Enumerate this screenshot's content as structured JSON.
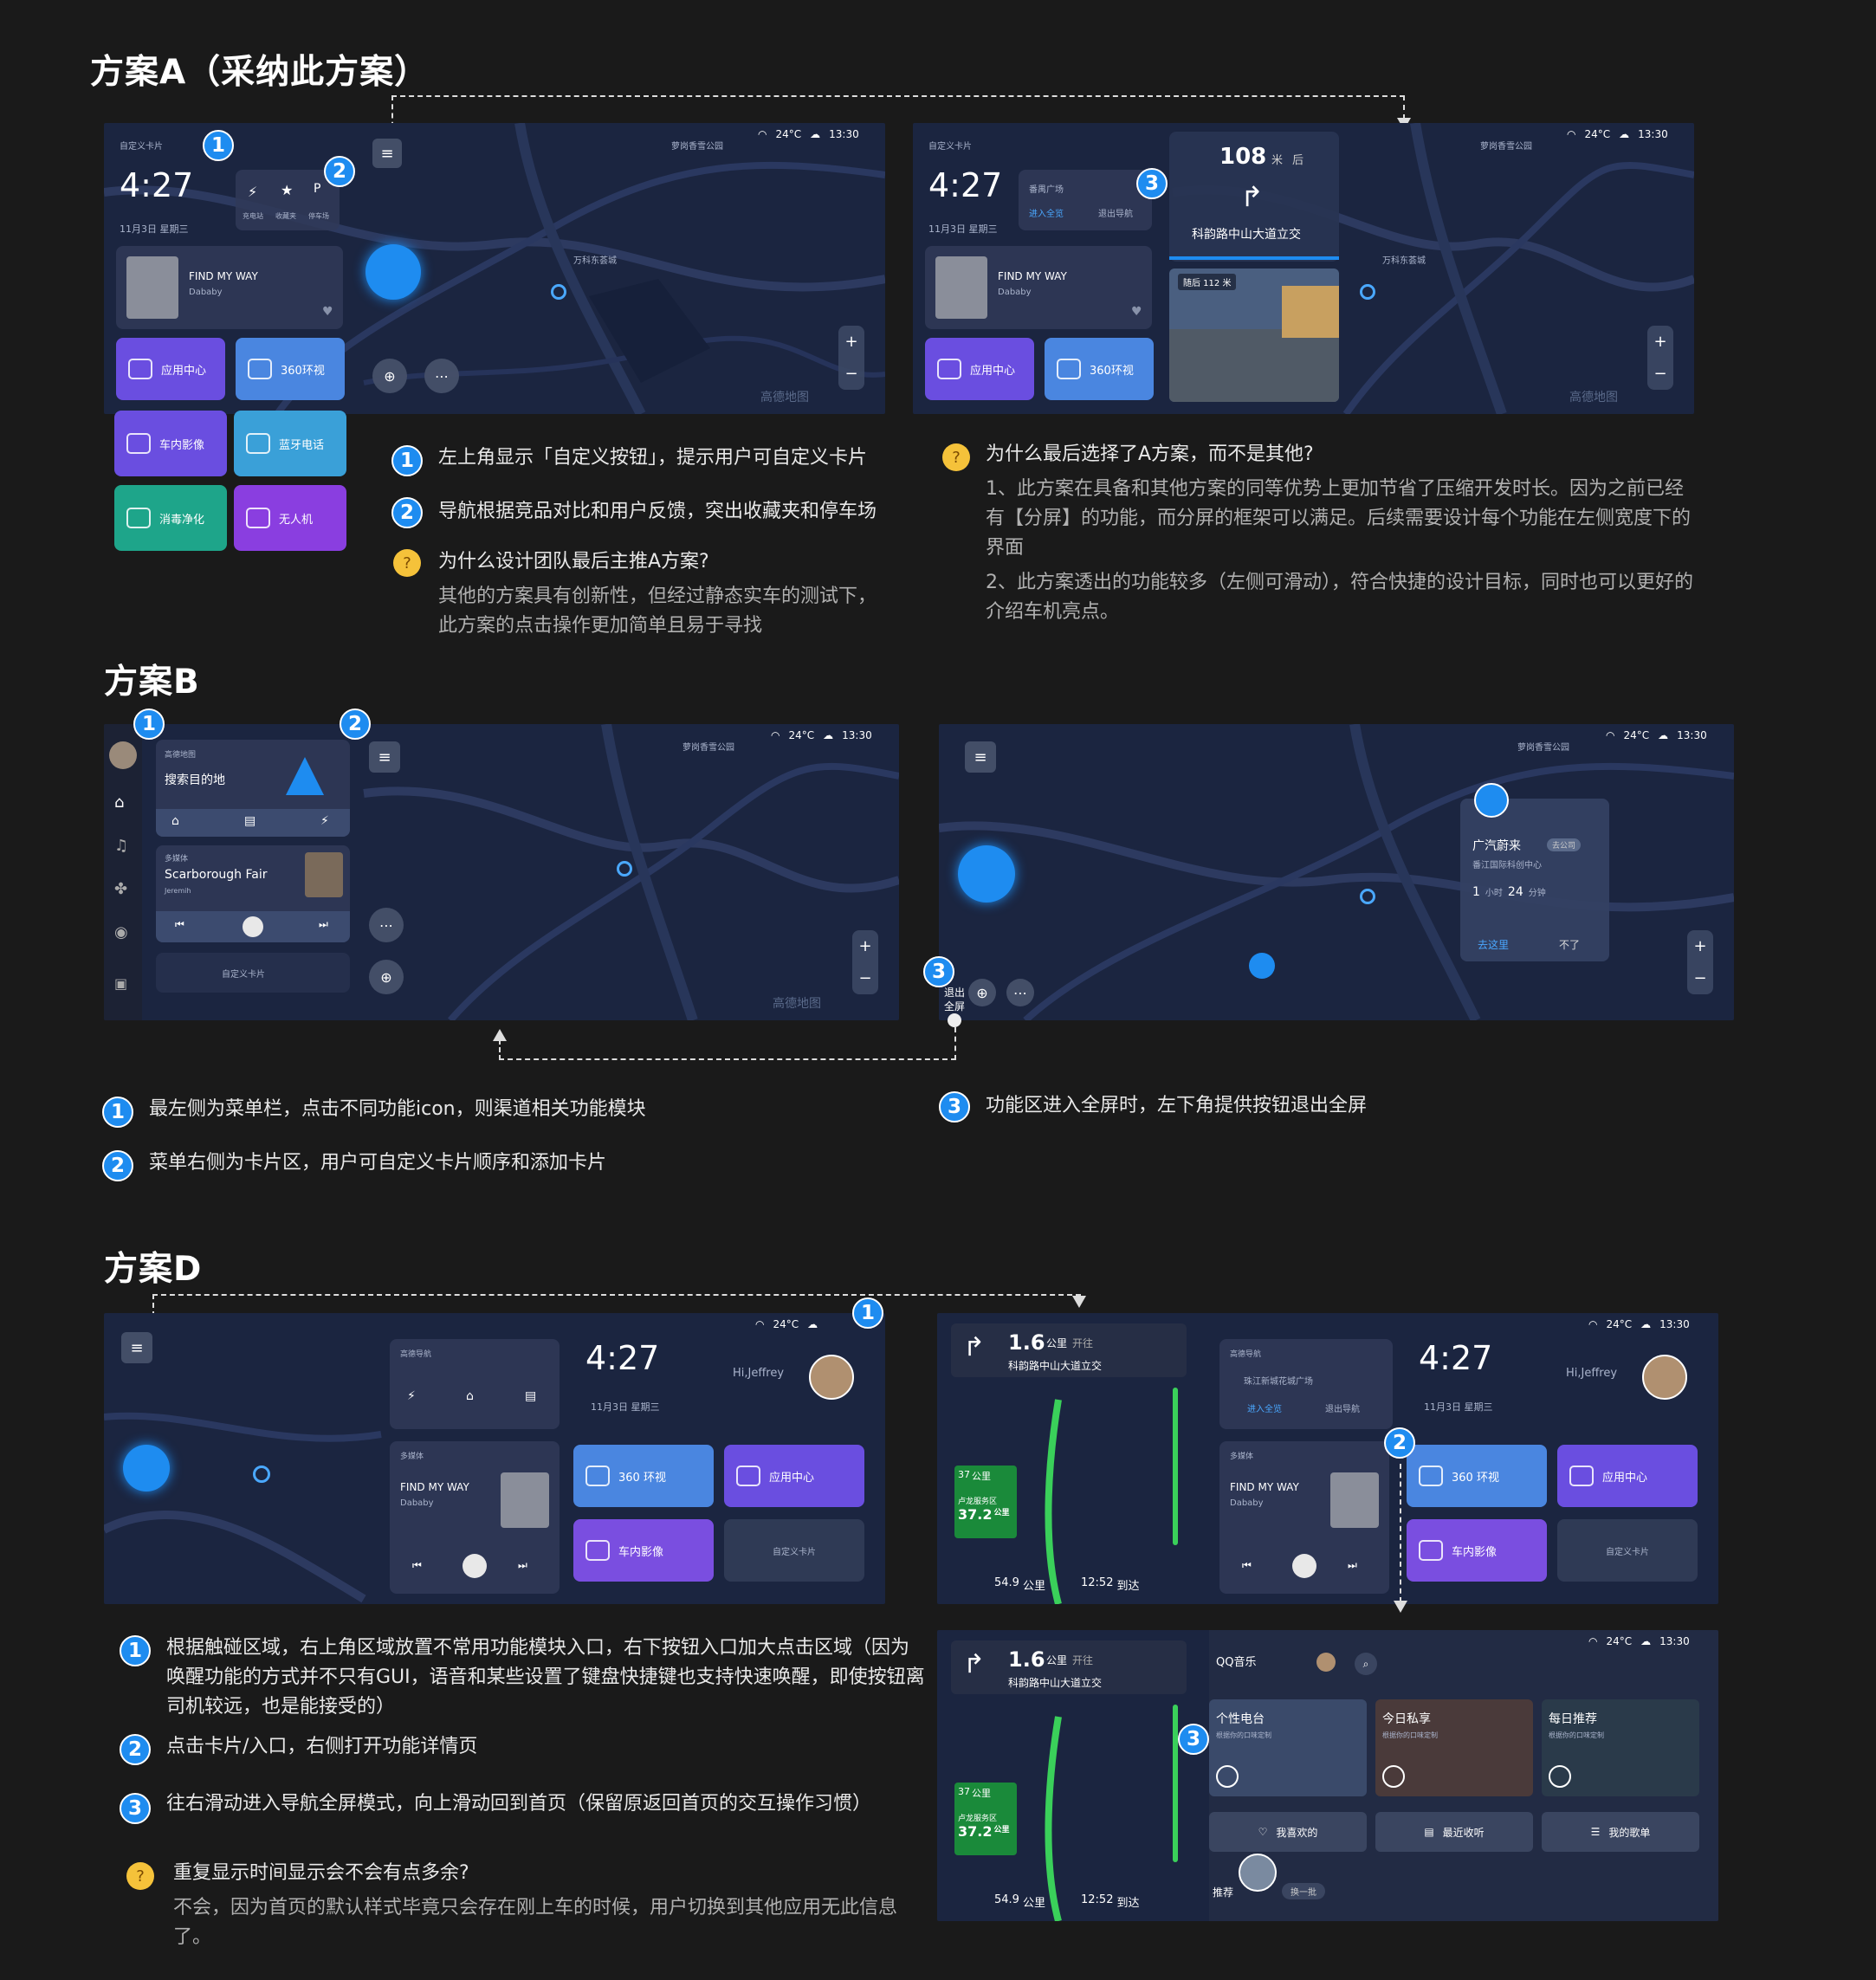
{
  "sections": {
    "a": "方案A（采纳此方案）",
    "b": "方案B",
    "d": "方案D"
  },
  "ui": {
    "time": "4:27",
    "date": "11月3日  星期三",
    "temp": "24°C",
    "clock": "13:30",
    "custom_card": "自定义卡片",
    "music_title": "FIND MY WAY",
    "music_artist": "Dababy",
    "app_center": "应用中心",
    "view360": "360环视",
    "view360_d": "360 环视",
    "car_video": "车内影像",
    "bt_phone": "蓝牙电话",
    "sanitize": "消毒净化",
    "drone": "无人机",
    "charge": "充电站",
    "fav": "收藏夹",
    "parking": "停车场",
    "map_brand": "高德地图",
    "park_name": "萝岗香雪公园",
    "wanke": "万科东荟城",
    "nav_dist": "108",
    "nav_unit": "米",
    "nav_after": "后",
    "nav_road": "科韵路中山大道立交",
    "nav_next": "随后 112 米",
    "nav_dest": "番禺广场",
    "nav_full": "进入全览",
    "nav_exit": "退出导航",
    "search_dest": "搜索目的地",
    "gaode_nav": "高德地图",
    "music_src": "多媒体",
    "music_b": "Scarborough Fair",
    "music_b_artist": "Jeremih",
    "poi_name": "广汽蔚来",
    "poi_tag": "去公司",
    "poi_addr": "番江国际科创中心",
    "poi_time_h": "1",
    "poi_time_h_unit": "小时",
    "poi_time_m": "24",
    "poi_time_m_unit": "分钟",
    "poi_go": "去这里",
    "poi_no": "不了",
    "exit_full": "退出全屏",
    "hi": "Hi,Jeffrey",
    "d_nav_src": "高德导航",
    "d_nav_dest": "珠江新城花城广场",
    "d_dist": "1.6",
    "d_unit": "公里",
    "d_action": "开往",
    "d_road": "科韵路中山大道立交",
    "d_km": "54.9",
    "d_km_unit": "公里",
    "d_eta": "12:52",
    "d_eta_unit": "到达",
    "d_hw": "37",
    "d_hw_unit": "公里",
    "d_svc": "卢龙服务区",
    "d_svc_dist": "37.2",
    "d_svc_unit": "公里",
    "qq": "QQ音乐",
    "qq_p1": "个性电台",
    "qq_p2": "今日私享",
    "qq_p3": "每日推荐",
    "qq_p_sub": "根据你的口味定制",
    "qq_b1": "我喜欢的",
    "qq_b2": "最近收听",
    "qq_b3": "我的歌单",
    "qq_rec": "推荐",
    "qq_refresh": "换一批"
  },
  "notes": {
    "a1": "左上角显示「自定义按钮」，提示用户可自定义卡片",
    "a2": "导航根据竞品对比和用户反馈，突出收藏夹和停车场",
    "a_q": "为什么设计团队最后主推A方案?",
    "a_q_ans": "其他的方案具有创新性，但经过静态实车的测试下，此方案的点击操作更加简单且易于寻找",
    "a_q2": "为什么最后选择了A方案，而不是其他?",
    "a_q2_1": "1、此方案在具备和其他方案的同等优势上更加节省了压缩开发时长。因为之前已经有【分屏】的功能，而分屏的框架可以满足。后续需要设计每个功能在左侧宽度下的界面",
    "a_q2_2": "2、此方案透出的功能较多（左侧可滑动），符合快捷的设计目标，同时也可以更好的介绍车机亮点。",
    "b1": "最左侧为菜单栏，点击不同功能icon，则渠道相关功能模块",
    "b2": "菜单右侧为卡片区，用户可自定义卡片顺序和添加卡片",
    "b3": "功能区进入全屏时，左下角提供按钮退出全屏",
    "d1": "根据触碰区域，右上角区域放置不常用功能模块入口，右下按钮入口加大点击区域（因为唤醒功能的方式并不只有GUI，语音和某些设置了键盘快捷键也支持快速唤醒，即使按钮离司机较远，也是能接受的）",
    "d2": "点击卡片/入口，右侧打开功能详情页",
    "d3": "往右滑动进入导航全屏模式，向上滑动回到首页（保留原返回首页的交互操作习惯）",
    "d_q": "重复显示时间显示会不会有点多余?",
    "d_q_ans": "不会，因为首页的默认样式毕竟只会存在刚上车的时候，用户切换到其他应用无此信息了。"
  },
  "badges": [
    "1",
    "2",
    "3"
  ],
  "colors": {
    "badge": "#1e8cf0",
    "bg": "#1a1a1a",
    "map": "#1b2540"
  }
}
